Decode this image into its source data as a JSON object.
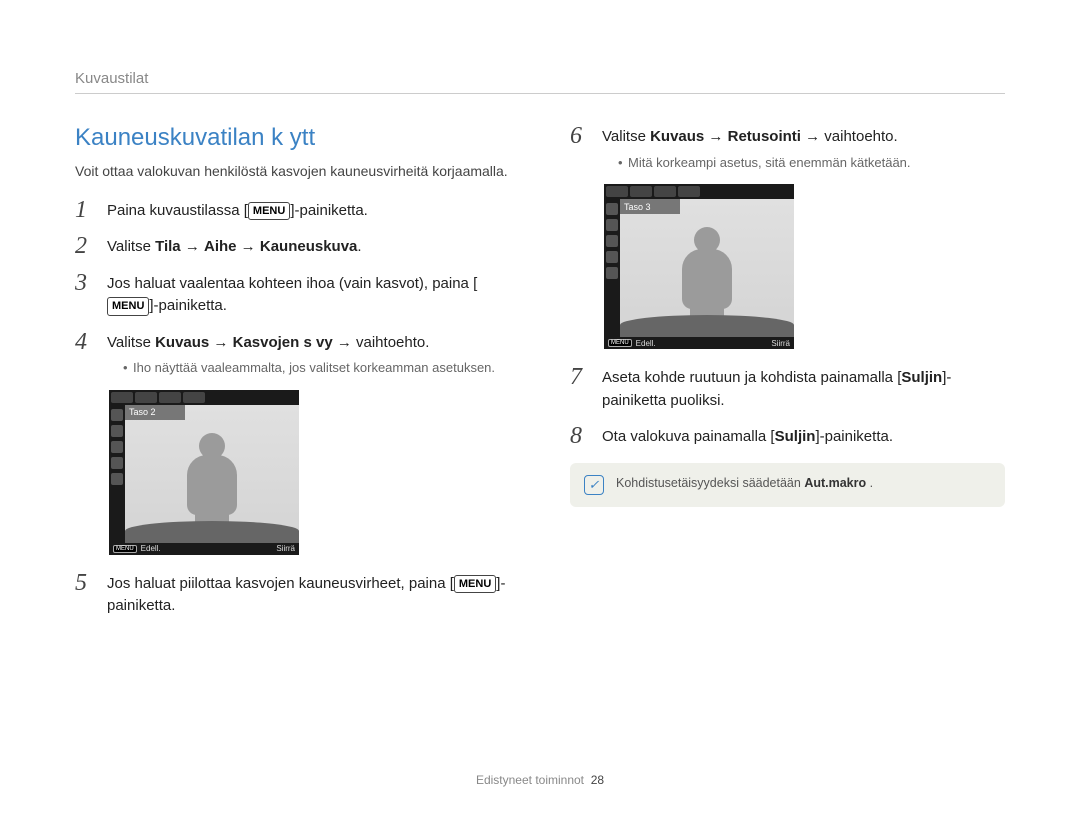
{
  "header": {
    "breadcrumb": "Kuvaustilat"
  },
  "title": "Kauneuskuvatilan k ytt",
  "intro": "Voit ottaa valokuvan henkilöstä kasvojen kauneusvirheitä korjaamalla.",
  "steps": {
    "s1": {
      "pre": "Paina kuvaustilassa [",
      "badge": "MENU",
      "post": "]-painiketta."
    },
    "s2": {
      "pre": "Valitse ",
      "b1": "Tila",
      "arr1": " → ",
      "b2": "Aihe",
      "arr2": " → ",
      "b3": "Kauneuskuva",
      "post": "."
    },
    "s3": {
      "pre": "Jos haluat vaalentaa kohteen ihoa (vain kasvot), paina [",
      "badge": "MENU",
      "post": "]-painiketta."
    },
    "s4": {
      "pre": "Valitse ",
      "b1": "Kuvaus",
      "arr1": " → ",
      "b2": "Kasvojen s vy",
      "arr2": " → vaihtoehto.",
      "bullet": "Iho näyttää vaaleammalta, jos valitset korkeamman asetuksen."
    },
    "s5": {
      "pre": "Jos haluat piilottaa kasvojen kauneusvirheet, paina [",
      "badge": "MENU",
      "post": "]-painiketta."
    },
    "s6": {
      "pre": "Valitse ",
      "b1": "Kuvaus",
      "arr1": " → ",
      "b2": "Retusointi",
      "arr2": " → vaihtoehto.",
      "bullet": "Mitä korkeampi asetus, sitä enemmän kätketään."
    },
    "s7": {
      "pre": "Aseta kohde ruutuun ja kohdista painamalla [",
      "b1": "Suljin",
      "post": "]-painiketta puoliksi."
    },
    "s8": {
      "pre": "Ota valokuva painamalla [",
      "b1": "Suljin",
      "post": "]-painiketta."
    }
  },
  "camshot1": {
    "level_label": "Taso 2",
    "bottom_left_badge": "MENU",
    "bottom_left": "Edell.",
    "bottom_right": "Siirrä"
  },
  "camshot2": {
    "level_label": "Taso 3",
    "bottom_left_badge": "MENU",
    "bottom_left": "Edell.",
    "bottom_right": "Siirrä"
  },
  "note": {
    "pre": "Kohdistusetäisyydeksi säädetään ",
    "bold": "Aut.makro",
    "post": " ."
  },
  "footer": {
    "section": "Edistyneet toiminnot",
    "page": "28"
  }
}
